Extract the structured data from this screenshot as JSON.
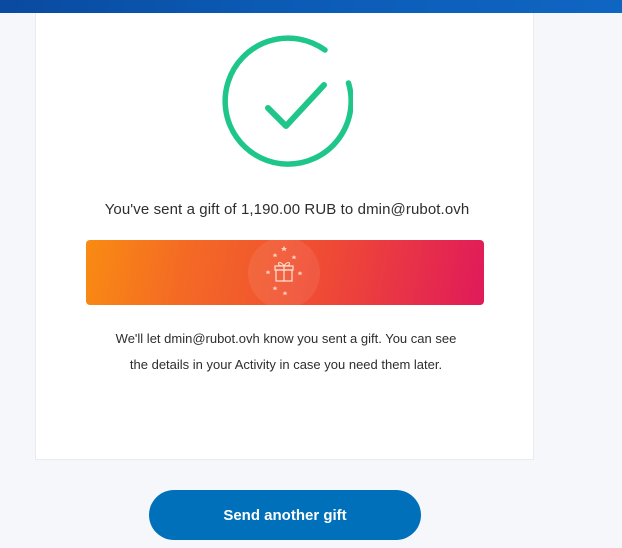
{
  "header": {
    "accent_color": "#0b5bb5"
  },
  "confirmation": {
    "icon": "checkmark-circle-icon",
    "icon_color": "#1fc68a",
    "sent_message": "You've sent a gift of 1,190.00 RUB to dmin@rubot.ovh",
    "banner_icon": "gift-icon",
    "info_message": "We'll let dmin@rubot.ovh know you sent a gift. You can see the details in your Activity in case you need them later."
  },
  "actions": {
    "send_another_label": "Send another gift",
    "button_color": "#0070ba"
  }
}
